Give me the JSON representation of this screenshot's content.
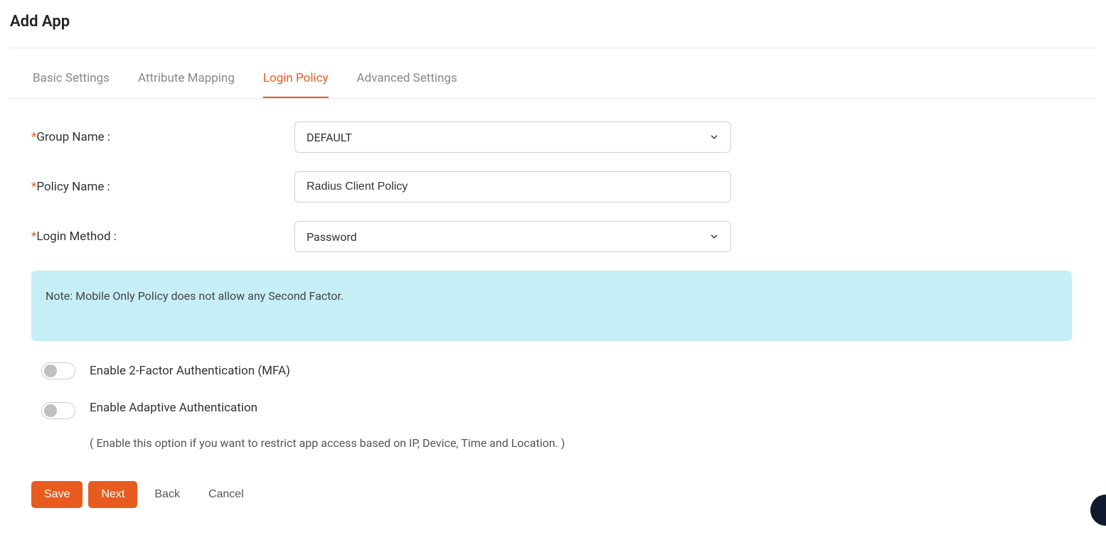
{
  "page": {
    "title": "Add App"
  },
  "tabs": [
    {
      "label": "Basic Settings",
      "active": false
    },
    {
      "label": "Attribute Mapping",
      "active": false
    },
    {
      "label": "Login Policy",
      "active": true
    },
    {
      "label": "Advanced Settings",
      "active": false
    }
  ],
  "form": {
    "groupName": {
      "label": "Group Name :",
      "required": true,
      "value": "DEFAULT"
    },
    "policyName": {
      "label": "Policy Name :",
      "required": true,
      "value": "Radius Client Policy"
    },
    "loginMethod": {
      "label": "Login Method :",
      "required": true,
      "value": "Password"
    }
  },
  "note": {
    "text": "Note: Mobile Only Policy does not allow any Second Factor."
  },
  "toggles": {
    "mfa": {
      "label": "Enable 2-Factor Authentication (MFA)",
      "enabled": false
    },
    "adaptive": {
      "label": "Enable Adaptive Authentication",
      "sublabel": "( Enable this option if you want to restrict app access based on IP, Device, Time and Location. )",
      "enabled": false
    }
  },
  "buttons": {
    "save": "Save",
    "next": "Next",
    "back": "Back",
    "cancel": "Cancel"
  }
}
